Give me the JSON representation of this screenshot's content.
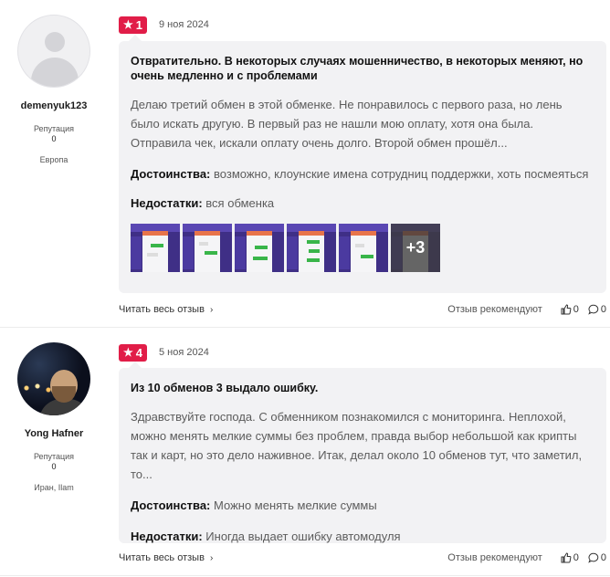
{
  "reviews": [
    {
      "author": {
        "name": "demenyuk123",
        "reputation_label": "Репутация",
        "reputation": "0",
        "location": "Европа",
        "avatar": "avatar-placeholder-icon"
      },
      "rating": "1",
      "date": "9 ноя 2024",
      "title": "Отвратительно. В некоторых случаях мошенничество, в некоторых меняют, но очень медленно и с проблемами",
      "text": "Делаю третий обмен в этой обменке. Не понравилось с первого раза, но лень было искать другую. В первый раз не нашли мою оплату, хотя она была. Отправила чек, искали оплату очень долго. Второй обмен прошёл...",
      "pros_label": "Достоинства:",
      "pros": "возможно, клоунские имена сотрудниц поддержки, хоть посмеяться",
      "cons_label": "Недостатки:",
      "cons": "вся обменка",
      "more_images": "+3",
      "read_more": "Читать весь отзыв",
      "recommends": "Отзыв рекомендуют",
      "likes": "0",
      "comments": "0"
    },
    {
      "author": {
        "name": "Yong Hafner",
        "reputation_label": "Репутация",
        "reputation": "0",
        "location": "Иран, Ilam",
        "avatar": "user-photo"
      },
      "rating": "4",
      "date": "5 ноя 2024",
      "title": "Из 10 обменов 3 выдало ошибку.",
      "text": "Здравствуйте господа. С обменником познакомился с мониторинга. Неплохой, можно менять мелкие суммы без проблем, правда выбор небольшой как крипты так и карт, но это дело наживное. Итак, делал около 10 обменов тут, что заметил, то...",
      "pros_label": "Достоинства:",
      "pros": "Можно менять мелкие суммы",
      "cons_label": "Недостатки:",
      "cons": "Иногда выдает ошибку автомодуля",
      "read_more": "Читать весь отзыв",
      "recommends": "Отзыв рекомендуют",
      "likes": "0",
      "comments": "0"
    }
  ],
  "colors": {
    "rating_badge": "#e11d48",
    "card_bg": "#f2f2f4"
  },
  "icons": {
    "star": "star-icon",
    "chevron": "chevron-right-icon",
    "like": "thumbs-up-icon",
    "comment": "comment-icon"
  }
}
